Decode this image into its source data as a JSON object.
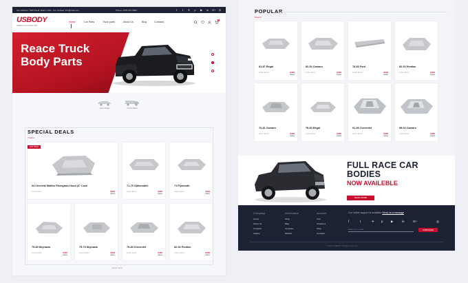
{
  "topbar": {
    "address": "Our Address: 7565 Doral, Miami, USA  ·  Our Contact: info@mail.com",
    "phone": "Phone: (478) 557-9899",
    "social": [
      "f",
      "t",
      "✈",
      "p",
      "▶",
      "in",
      "G+",
      "◎"
    ]
  },
  "logo": {
    "main": "USBODY",
    "tagline": "FIBERGLASS SINCE 1987"
  },
  "nav": [
    "Home",
    "Car Parts",
    "Truck parts",
    "About Us",
    "Blog",
    "Contacts"
  ],
  "nav_icons": [
    "search-icon",
    "heart-icon",
    "user-icon",
    "cart-icon"
  ],
  "cart_count": "2",
  "hero": {
    "title": "Reace Truck Body Parts"
  },
  "vehicle_types": [
    "Cars Parts",
    "Truck Parts"
  ],
  "special": {
    "title": "SPECIAL DEALS",
    "subtitle": "7 items",
    "badge": "HOT SALE",
    "items": [
      {
        "name": "64 Chevelle Malibu Fiberglass Hood (4\" Cowl",
        "meta": "Lorem Ipsum",
        "price": "$429",
        "old": "$501"
      },
      {
        "name": "71-75 Oldsmobile",
        "meta": "Lorem Ipsum",
        "price": "$429",
        "old": "$501"
      },
      {
        "name": "71 Plymouth",
        "meta": "Lorem Ipsum",
        "price": "$429",
        "old": "$501"
      },
      {
        "name": "75-80 Skyhawk",
        "meta": "Lorem Ipsum",
        "price": "$429",
        "old": "$501"
      },
      {
        "name": "75-79 Skyhawk",
        "meta": "Lorem Ipsum",
        "price": "$429",
        "old": "$501"
      },
      {
        "name": "75-80 Chevrolet",
        "meta": "Lorem Ipsum",
        "price": "$429",
        "old": "$501"
      },
      {
        "name": "82-92 Pontiac",
        "meta": "Lorem Ipsum",
        "price": "$429",
        "old": "$501"
      }
    ],
    "show_more": "show more"
  },
  "popular": {
    "title": "POPULAR",
    "subtitle": "8 items",
    "items": [
      {
        "name": "81-87 Regal",
        "meta": "Lorem Ipsum",
        "price": "$429",
        "old": "$501"
      },
      {
        "name": "82-92 Camaro",
        "meta": "Lorem Ipsum",
        "price": "$429",
        "old": "$501"
      },
      {
        "name": "78-83 Ford",
        "meta": "Lorem Ipsum",
        "price": "$199",
        "old": "$265"
      },
      {
        "name": "82-92 Pontiac",
        "meta": "Lorem Ipsum",
        "price": "$429",
        "old": "$501"
      },
      {
        "name": "70-81 Camaro",
        "meta": "Lorem Ipsum",
        "price": "$429",
        "old": "$501"
      },
      {
        "name": "78-80 Regal",
        "meta": "Lorem Ipsum",
        "price": "$429",
        "old": "$501"
      },
      {
        "name": "91-96 Chevrolet",
        "meta": "Lorem Ipsum",
        "price": "$429",
        "old": "$501"
      },
      {
        "name": "98-02 Camaro",
        "meta": "Lorem Ipsum",
        "price": "$429",
        "old": "$501"
      }
    ]
  },
  "promo": {
    "title": "FULL RACE CAR BODIES",
    "subtitle": "NOW AVAILEBLE",
    "button": "READ MORE"
  },
  "footer": {
    "columns": [
      {
        "head": "Company",
        "links": [
          "Home",
          "About Us",
          "Contacts",
          "Gallery"
        ]
      },
      {
        "head": "Information",
        "links": [
          "Shop",
          "Blog",
          "Compare",
          "Wishlist"
        ]
      },
      {
        "head": "Account",
        "links": [
          "Cart",
          "Checkout",
          "Shop",
          "Contacts"
        ]
      }
    ],
    "support_text": "Our online support is available",
    "support_link": "Send us a message",
    "social": [
      "f",
      "t",
      "✈",
      "p",
      "▶",
      "in",
      "G+",
      "◎"
    ],
    "email_placeholder": "Enter your email",
    "subscribe": "SUBSCRIBE",
    "copyright": "© 2019 USBODY. All rights reserved"
  },
  "colors": {
    "accent": "#c8102e",
    "dark": "#1c2133"
  }
}
